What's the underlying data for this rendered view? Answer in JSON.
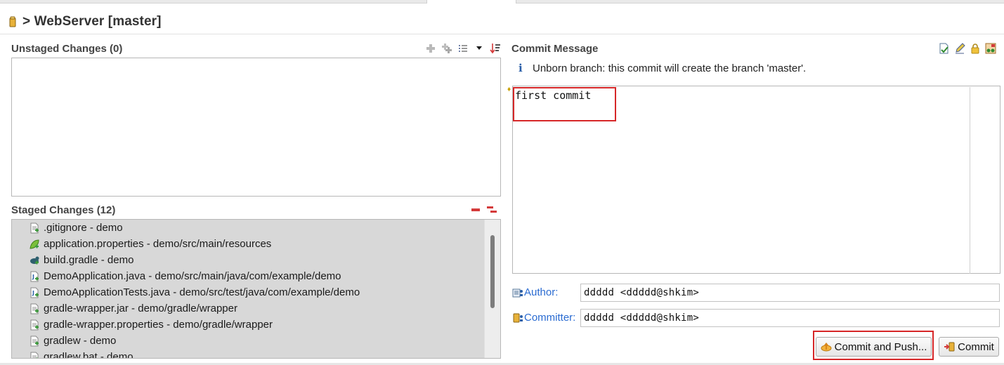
{
  "header": {
    "title": "> WebServer [master]"
  },
  "unstaged": {
    "title": "Unstaged Changes (0)"
  },
  "staged": {
    "title": "Staged Changes (12)",
    "items": [
      {
        "label": ".gitignore - demo",
        "icon": "text-file-icon"
      },
      {
        "label": "application.properties - demo/src/main/resources",
        "icon": "properties-leaf-icon"
      },
      {
        "label": "build.gradle - demo",
        "icon": "gradle-icon"
      },
      {
        "label": "DemoApplication.java - demo/src/main/java/com/example/demo",
        "icon": "java-file-icon"
      },
      {
        "label": "DemoApplicationTests.java - demo/src/test/java/com/example/demo",
        "icon": "java-file-icon"
      },
      {
        "label": "gradle-wrapper.jar - demo/gradle/wrapper",
        "icon": "text-file-icon"
      },
      {
        "label": "gradle-wrapper.properties - demo/gradle/wrapper",
        "icon": "text-file-icon"
      },
      {
        "label": "gradlew - demo",
        "icon": "text-file-icon"
      },
      {
        "label": "gradlew.bat - demo",
        "icon": "text-file-icon"
      }
    ]
  },
  "commit": {
    "title": "Commit Message",
    "info": "Unborn branch: this commit will create the branch 'master'.",
    "message": "first commit",
    "author_label": "Author:",
    "author_value": "ddddd <ddddd@shkim>",
    "committer_label": "Committer:",
    "committer_value": "ddddd <ddddd@shkim>",
    "commit_push_label": "Commit and Push...",
    "commit_label": "Commit"
  },
  "colors": {
    "highlight": "#d62728",
    "link": "#2a6bd1",
    "minus": "#d43a3a"
  }
}
